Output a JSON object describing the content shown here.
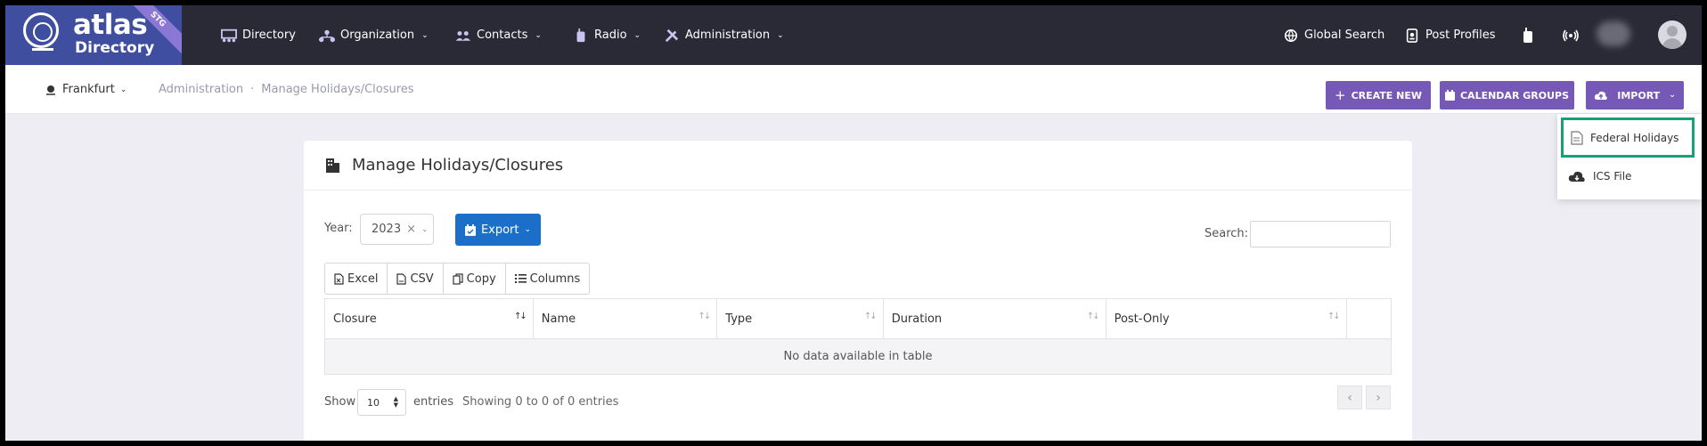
{
  "logo": {
    "line1": "atlas",
    "line2": "Directory",
    "badge": "STG"
  },
  "nav": {
    "items": [
      {
        "label": "Directory",
        "icon": "directory-icon",
        "dropdown": false
      },
      {
        "label": "Organization",
        "icon": "organization-icon",
        "dropdown": true
      },
      {
        "label": "Contacts",
        "icon": "contacts-icon",
        "dropdown": true
      },
      {
        "label": "Radio",
        "icon": "radio-icon",
        "dropdown": true
      },
      {
        "label": "Administration",
        "icon": "tools-icon",
        "dropdown": true
      }
    ],
    "global_search": "Global Search",
    "post_profiles": "Post Profiles"
  },
  "subbar": {
    "location": "Frankfurt",
    "breadcrumb": [
      "Administration",
      "Manage Holidays/Closures"
    ],
    "buttons": {
      "create_new": "CREATE NEW",
      "calendar_groups": "CALENDAR GROUPS",
      "import": "IMPORT"
    }
  },
  "card": {
    "title": "Manage Holidays/Closures",
    "year_label": "Year:",
    "year_value": "2023",
    "export_label": "Export",
    "search_label": "Search:",
    "toolbar": [
      "Excel",
      "CSV",
      "Copy",
      "Columns"
    ],
    "columns": [
      "Closure",
      "Name",
      "Type",
      "Duration",
      "Post-Only",
      ""
    ],
    "empty_message": "No data available in table",
    "show_label": "Show",
    "page_size": "10",
    "entries_label": "entries",
    "info": "Showing 0 to 0 of 0 entries"
  },
  "import_menu": {
    "items": [
      "Federal Holidays",
      "ICS File"
    ]
  },
  "colors": {
    "nav_bg": "#2a2a36",
    "logo_bg": "#3f4e9e",
    "primary_purple": "#7659b6",
    "export_blue": "#1c6fc9",
    "highlight_green": "#15a077"
  }
}
